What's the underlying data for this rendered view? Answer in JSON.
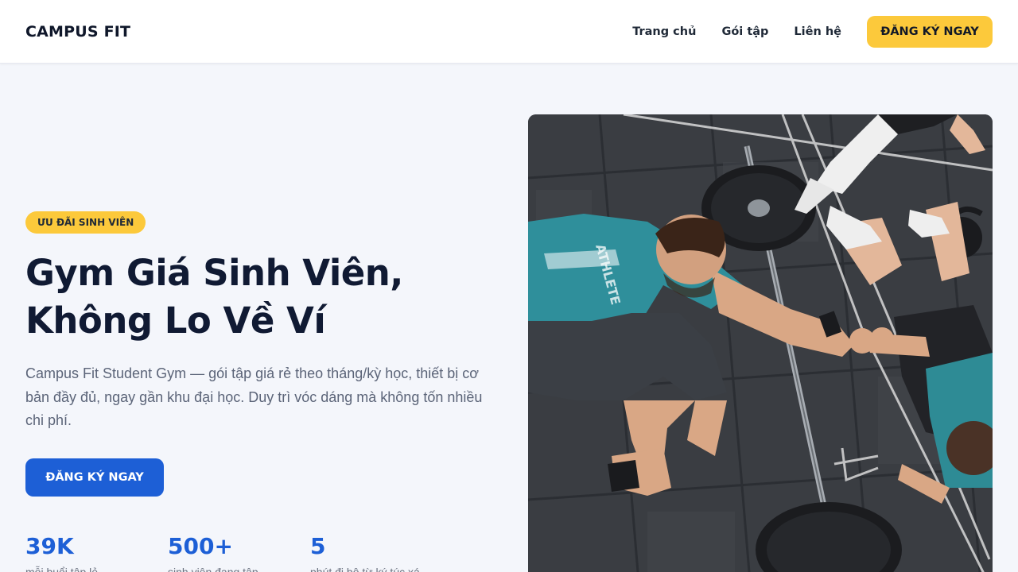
{
  "nav": {
    "brand": "CAMPUS FIT",
    "links": [
      "Trang chủ",
      "Gói tập",
      "Liên hệ"
    ],
    "cta": "ĐĂNG KÝ NGAY"
  },
  "hero": {
    "badge": "ƯU ĐÃI SINH VIÊN",
    "headline_line1": "Gym Giá Sinh Viên,",
    "headline_line2": "Không Lo Về Ví",
    "description": "Campus Fit Student Gym — gói tập giá rẻ theo tháng/kỳ học, thiết bị cơ bản đầy đủ, ngay gần khu đại học. Duy trì vóc dáng mà không tốn nhiều chi phí.",
    "cta": "ĐĂNG KÝ NGAY",
    "image_alt_icon": "gym-photo",
    "shirt_text": "ATHLETE"
  },
  "stats": [
    {
      "value": "39K",
      "label": "mỗi buổi tập lẻ"
    },
    {
      "value": "500+",
      "label": "sinh viên đang tập"
    },
    {
      "value": "5",
      "label": "phút đi bộ từ ký túc xá"
    }
  ],
  "colors": {
    "accent_yellow": "#fcc93b",
    "primary_blue": "#1d5fd6",
    "heading": "#101a33",
    "background": "#f4f6fb"
  }
}
